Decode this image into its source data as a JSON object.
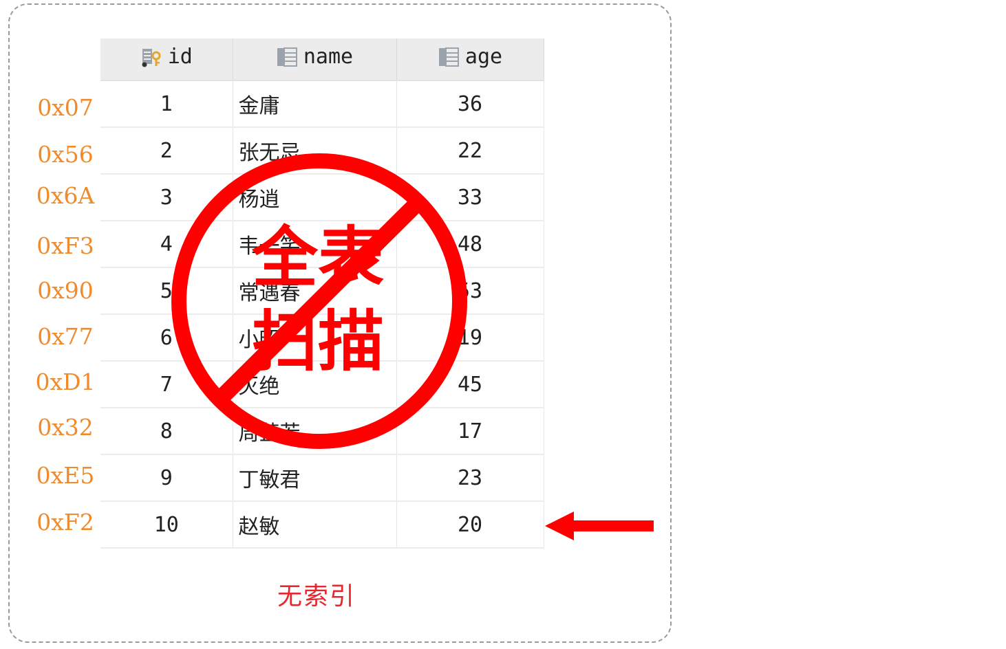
{
  "table": {
    "columns": [
      {
        "label": "id",
        "icon": "key-column-icon"
      },
      {
        "label": "name",
        "icon": "table-column-icon"
      },
      {
        "label": "age",
        "icon": "table-column-icon"
      }
    ],
    "rows": [
      {
        "addr": "0x07",
        "id": "1",
        "name": "金庸",
        "age": "36"
      },
      {
        "addr": "0x56",
        "id": "2",
        "name": "张无忌",
        "age": "22"
      },
      {
        "addr": "0x6A",
        "id": "3",
        "name": "杨逍",
        "age": "33"
      },
      {
        "addr": "0xF3",
        "id": "4",
        "name": "韦一笑",
        "age": "48"
      },
      {
        "addr": "0x90",
        "id": "5",
        "name": "常遇春",
        "age": "53"
      },
      {
        "addr": "0x77",
        "id": "6",
        "name": "小昭",
        "age": "19"
      },
      {
        "addr": "0xD1",
        "id": "7",
        "name": "灭绝",
        "age": "45"
      },
      {
        "addr": "0x32",
        "id": "8",
        "name": "周芷若",
        "age": "17"
      },
      {
        "addr": "0xE5",
        "id": "9",
        "name": "丁敏君",
        "age": "23"
      },
      {
        "addr": "0xF2",
        "id": "10",
        "name": "赵敏",
        "age": "20"
      }
    ]
  },
  "stamp": {
    "line1": "全表",
    "line2": "扫描",
    "icon": "prohibited-icon",
    "color": "#ff0000"
  },
  "arrow": {
    "icon": "arrow-left-icon",
    "color": "#ff0000"
  },
  "caption": "无索引",
  "colors": {
    "address": "#f08a2a",
    "caption": "#e8262d",
    "header_bg": "#ececec"
  }
}
